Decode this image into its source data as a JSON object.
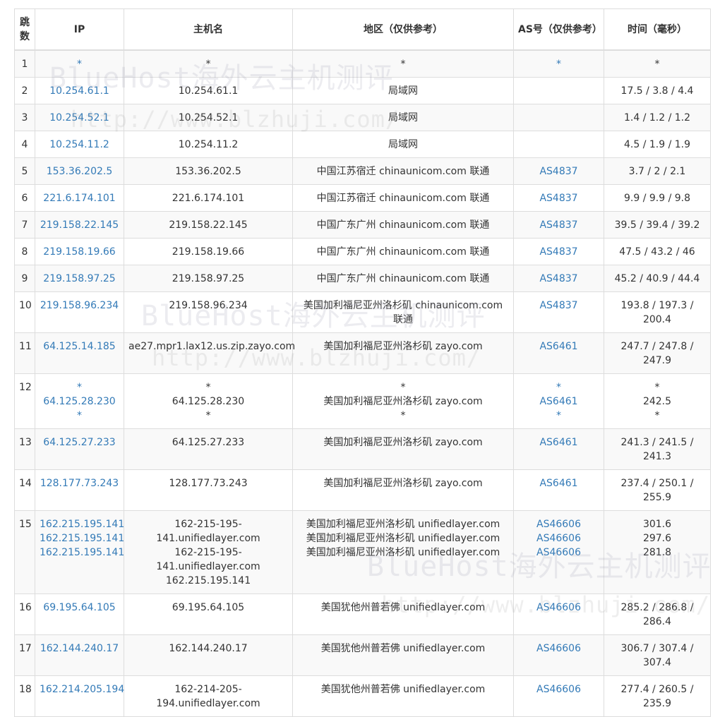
{
  "headers": {
    "hop": "跳数",
    "ip": "IP",
    "host": "主机名",
    "region": "地区（仅供参考）",
    "asn": "AS号（仅供参考）",
    "time": "时间（毫秒）"
  },
  "watermark": {
    "brand": "BlueHost海外云主机测评",
    "url": "http://www.blzhuji.com/"
  },
  "rows": [
    {
      "hop": "1",
      "ip": [
        "*"
      ],
      "host": [
        "*"
      ],
      "region": [
        "*"
      ],
      "asn": [
        "*"
      ],
      "time": [
        "*"
      ]
    },
    {
      "hop": "2",
      "ip": [
        "10.254.61.1"
      ],
      "host": [
        "10.254.61.1"
      ],
      "region": [
        "局域网"
      ],
      "asn": [
        ""
      ],
      "time": [
        "17.5 / 3.8 / 4.4"
      ]
    },
    {
      "hop": "3",
      "ip": [
        "10.254.52.1"
      ],
      "host": [
        "10.254.52.1"
      ],
      "region": [
        "局域网"
      ],
      "asn": [
        ""
      ],
      "time": [
        "1.4 / 1.2 / 1.2"
      ]
    },
    {
      "hop": "4",
      "ip": [
        "10.254.11.2"
      ],
      "host": [
        "10.254.11.2"
      ],
      "region": [
        "局域网"
      ],
      "asn": [
        ""
      ],
      "time": [
        "4.5 / 1.9 / 1.9"
      ]
    },
    {
      "hop": "5",
      "ip": [
        "153.36.202.5"
      ],
      "host": [
        "153.36.202.5"
      ],
      "region": [
        "中国江苏宿迁 chinaunicom.com 联通"
      ],
      "asn": [
        "AS4837"
      ],
      "time": [
        "3.7 / 2 / 2.1"
      ]
    },
    {
      "hop": "6",
      "ip": [
        "221.6.174.101"
      ],
      "host": [
        "221.6.174.101"
      ],
      "region": [
        "中国江苏宿迁 chinaunicom.com 联通"
      ],
      "asn": [
        "AS4837"
      ],
      "time": [
        "9.9 / 9.9 / 9.8"
      ]
    },
    {
      "hop": "7",
      "ip": [
        "219.158.22.145"
      ],
      "host": [
        "219.158.22.145"
      ],
      "region": [
        "中国广东广州 chinaunicom.com 联通"
      ],
      "asn": [
        "AS4837"
      ],
      "time": [
        "39.5 / 39.4 / 39.2"
      ]
    },
    {
      "hop": "8",
      "ip": [
        "219.158.19.66"
      ],
      "host": [
        "219.158.19.66"
      ],
      "region": [
        "中国广东广州 chinaunicom.com 联通"
      ],
      "asn": [
        "AS4837"
      ],
      "time": [
        "47.5 / 43.2 / 46"
      ]
    },
    {
      "hop": "9",
      "ip": [
        "219.158.97.25"
      ],
      "host": [
        "219.158.97.25"
      ],
      "region": [
        "中国广东广州 chinaunicom.com 联通"
      ],
      "asn": [
        "AS4837"
      ],
      "time": [
        "45.2 / 40.9 / 44.4"
      ]
    },
    {
      "hop": "10",
      "ip": [
        "219.158.96.234"
      ],
      "host": [
        "219.158.96.234"
      ],
      "region": [
        "美国加利福尼亚州洛杉矶 chinaunicom.com 联通"
      ],
      "asn": [
        "AS4837"
      ],
      "time": [
        "193.8 / 197.3 / 200.4"
      ]
    },
    {
      "hop": "11",
      "ip": [
        "64.125.14.185"
      ],
      "host": [
        "ae27.mpr1.lax12.us.zip.zayo.com"
      ],
      "region": [
        "美国加利福尼亚州洛杉矶 zayo.com"
      ],
      "asn": [
        "AS6461"
      ],
      "time": [
        "247.7 / 247.8 / 247.9"
      ]
    },
    {
      "hop": "12",
      "ip": [
        "*",
        "64.125.28.230",
        "*"
      ],
      "host": [
        "*",
        "64.125.28.230",
        "*"
      ],
      "region": [
        "*",
        "美国加利福尼亚州洛杉矶 zayo.com",
        "*"
      ],
      "asn": [
        "*",
        "AS6461",
        "*"
      ],
      "time": [
        "*",
        "242.5",
        "*"
      ]
    },
    {
      "hop": "13",
      "ip": [
        "64.125.27.233"
      ],
      "host": [
        "64.125.27.233"
      ],
      "region": [
        "美国加利福尼亚州洛杉矶 zayo.com"
      ],
      "asn": [
        "AS6461"
      ],
      "time": [
        "241.3 / 241.5 / 241.3"
      ]
    },
    {
      "hop": "14",
      "ip": [
        "128.177.73.243"
      ],
      "host": [
        "128.177.73.243"
      ],
      "region": [
        "美国加利福尼亚州洛杉矶 zayo.com"
      ],
      "asn": [
        "AS6461"
      ],
      "time": [
        "237.4 / 250.1 / 255.9"
      ]
    },
    {
      "hop": "15",
      "ip": [
        "162.215.195.141",
        "162.215.195.141",
        "162.215.195.141"
      ],
      "host": [
        "162-215-195-141.unifiedlayer.com",
        "162-215-195-141.unifiedlayer.com",
        "162.215.195.141"
      ],
      "region": [
        "美国加利福尼亚州洛杉矶 unifiedlayer.com",
        "美国加利福尼亚州洛杉矶 unifiedlayer.com",
        "美国加利福尼亚州洛杉矶 unifiedlayer.com"
      ],
      "asn": [
        "AS46606",
        "AS46606",
        "AS46606"
      ],
      "time": [
        "301.6",
        "297.6",
        "281.8"
      ]
    },
    {
      "hop": "16",
      "ip": [
        "69.195.64.105"
      ],
      "host": [
        "69.195.64.105"
      ],
      "region": [
        "美国犹他州普若佛 unifiedlayer.com"
      ],
      "asn": [
        "AS46606"
      ],
      "time": [
        "285.2 / 286.8 / 286.4"
      ]
    },
    {
      "hop": "17",
      "ip": [
        "162.144.240.17"
      ],
      "host": [
        "162.144.240.17"
      ],
      "region": [
        "美国犹他州普若佛 unifiedlayer.com"
      ],
      "asn": [
        "AS46606"
      ],
      "time": [
        "306.7 / 307.4 / 307.4"
      ]
    },
    {
      "hop": "18",
      "ip": [
        "162.214.205.194"
      ],
      "host": [
        "162-214-205-194.unifiedlayer.com"
      ],
      "region": [
        "美国犹他州普若佛 unifiedlayer.com"
      ],
      "asn": [
        "AS46606"
      ],
      "time": [
        "277.4 / 260.5 / 235.9"
      ]
    }
  ]
}
